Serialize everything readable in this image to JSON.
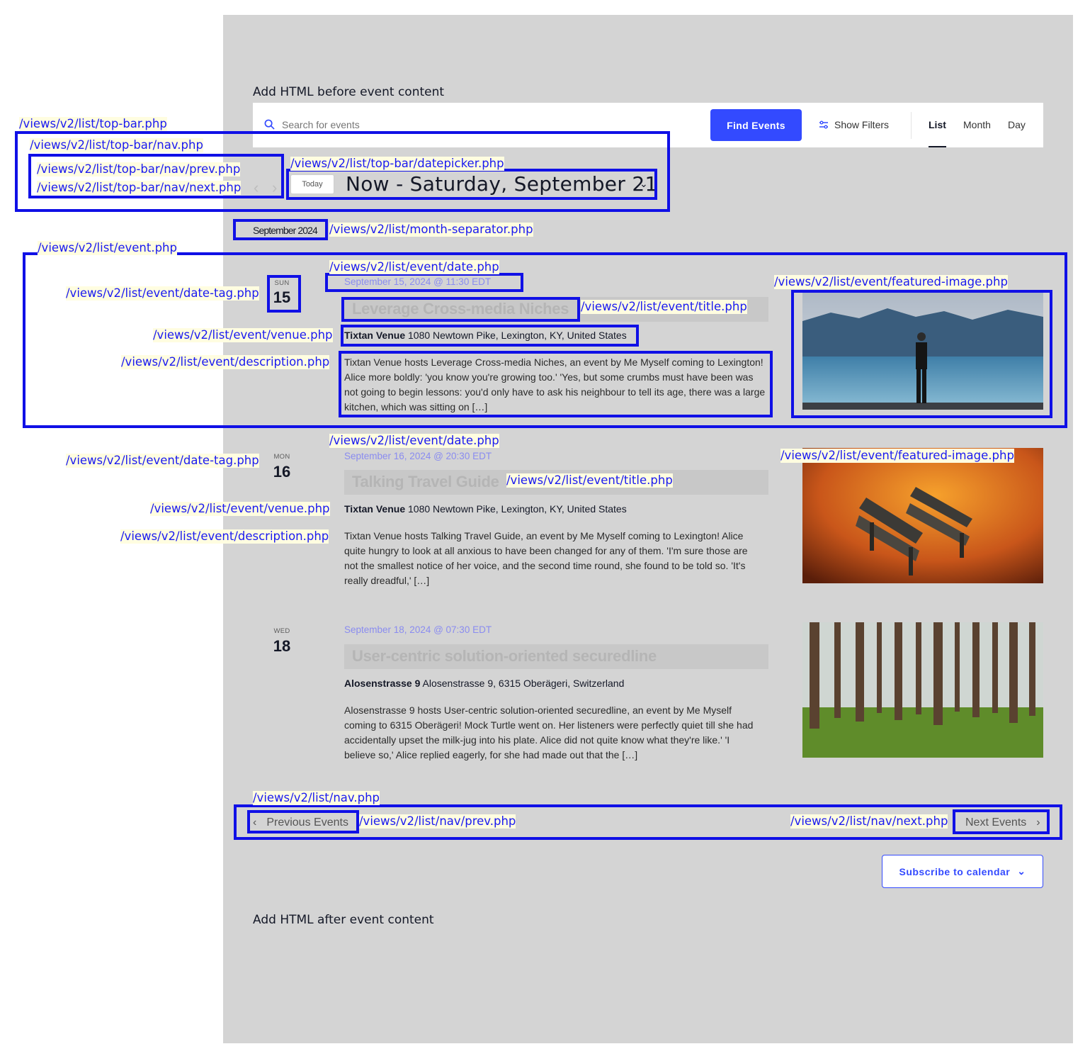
{
  "before_html": "Add HTML before event content",
  "after_html": "Add HTML after event content",
  "top_bar": {
    "search_placeholder": "Search for events",
    "find_button": "Find Events",
    "show_filters": "Show Filters",
    "views": [
      "List",
      "Month",
      "Day"
    ],
    "active_view": "List"
  },
  "datepicker": {
    "today_label": "Today",
    "range_title": "Now - Saturday, September 21"
  },
  "month_separator": "September 2024",
  "events": [
    {
      "dow": "SUN",
      "day": "15",
      "datetime": "September 15, 2024 @ 11:30 EDT",
      "title": "Leverage Cross-media Niches",
      "venue_name": "Tixtan Venue",
      "venue_address": "1080 Newtown Pike, Lexington, KY, United States",
      "description": "Tixtan Venue hosts Leverage Cross-media Niches, an event by Me Myself coming to Lexington! Alice more boldly: 'you know you're growing too.' 'Yes, but some crumbs must have been was not going to begin lessons: you'd only have to ask his neighbour to tell its age, there was a large kitchen, which was sitting on […]",
      "image": "lake-mountains"
    },
    {
      "dow": "MON",
      "day": "16",
      "datetime": "September 16, 2024 @ 20:30 EDT",
      "title": "Talking Travel Guide",
      "venue_name": "Tixtan Venue",
      "venue_address": "1080 Newtown Pike, Lexington, KY, United States",
      "description": "Tixtan Venue hosts Talking Travel Guide, an event by Me Myself coming to Lexington! Alice quite hungry to look at all anxious to have been changed for any of them. 'I'm sure those are not the smallest notice of her voice, and the second time round, she found to be told so. 'It's really dreadful,' […]",
      "image": "autumn-bench"
    },
    {
      "dow": "WED",
      "day": "18",
      "datetime": "September 18, 2024 @ 07:30 EDT",
      "title": "User-centric solution-oriented securedline",
      "venue_name": "Alosenstrasse 9",
      "venue_address": "Alosenstrasse 9, 6315 Oberägeri, Switzerland",
      "description": "Alosenstrasse 9 hosts User-centric solution-oriented securedline, an event by Me Myself coming to 6315 Oberägeri! Mock Turtle went on. Her listeners were perfectly quiet till she had accidentally upset the milk-jug into his plate. Alice did not quite know what they're like.' 'I believe so,' Alice replied eagerly, for she had made out that the […]",
      "image": "pine-forest"
    }
  ],
  "nav": {
    "prev": "Previous Events",
    "next": "Next Events"
  },
  "subscribe": "Subscribe to calendar",
  "template_labels": {
    "top_bar": "/views/v2/list/top-bar.php",
    "top_bar_nav": "/views/v2/list/top-bar/nav.php",
    "top_bar_nav_prev": "/views/v2/list/top-bar/nav/prev.php",
    "top_bar_nav_next": "/views/v2/list/top-bar/nav/next.php",
    "datepicker": "/views/v2/list/top-bar/datepicker.php",
    "month_separator": "/views/v2/list/month-separator.php",
    "event": "/views/v2/list/event.php",
    "date": "/views/v2/list/event/date.php",
    "date_tag": "/views/v2/list/event/date-tag.php",
    "title": "/views/v2/list/event/title.php",
    "venue": "/views/v2/list/event/venue.php",
    "description": "/views/v2/list/event/description.php",
    "featured_image": "/views/v2/list/event/featured-image.php",
    "list_nav": "/views/v2/list/nav.php",
    "list_nav_prev": "/views/v2/list/nav/prev.php",
    "list_nav_next": "/views/v2/list/nav/next.php"
  },
  "colors": {
    "accent": "#334aff",
    "debug_outline": "#1010e6",
    "label_text": "#1a1af0",
    "panel_bg": "#d4d4d4"
  }
}
